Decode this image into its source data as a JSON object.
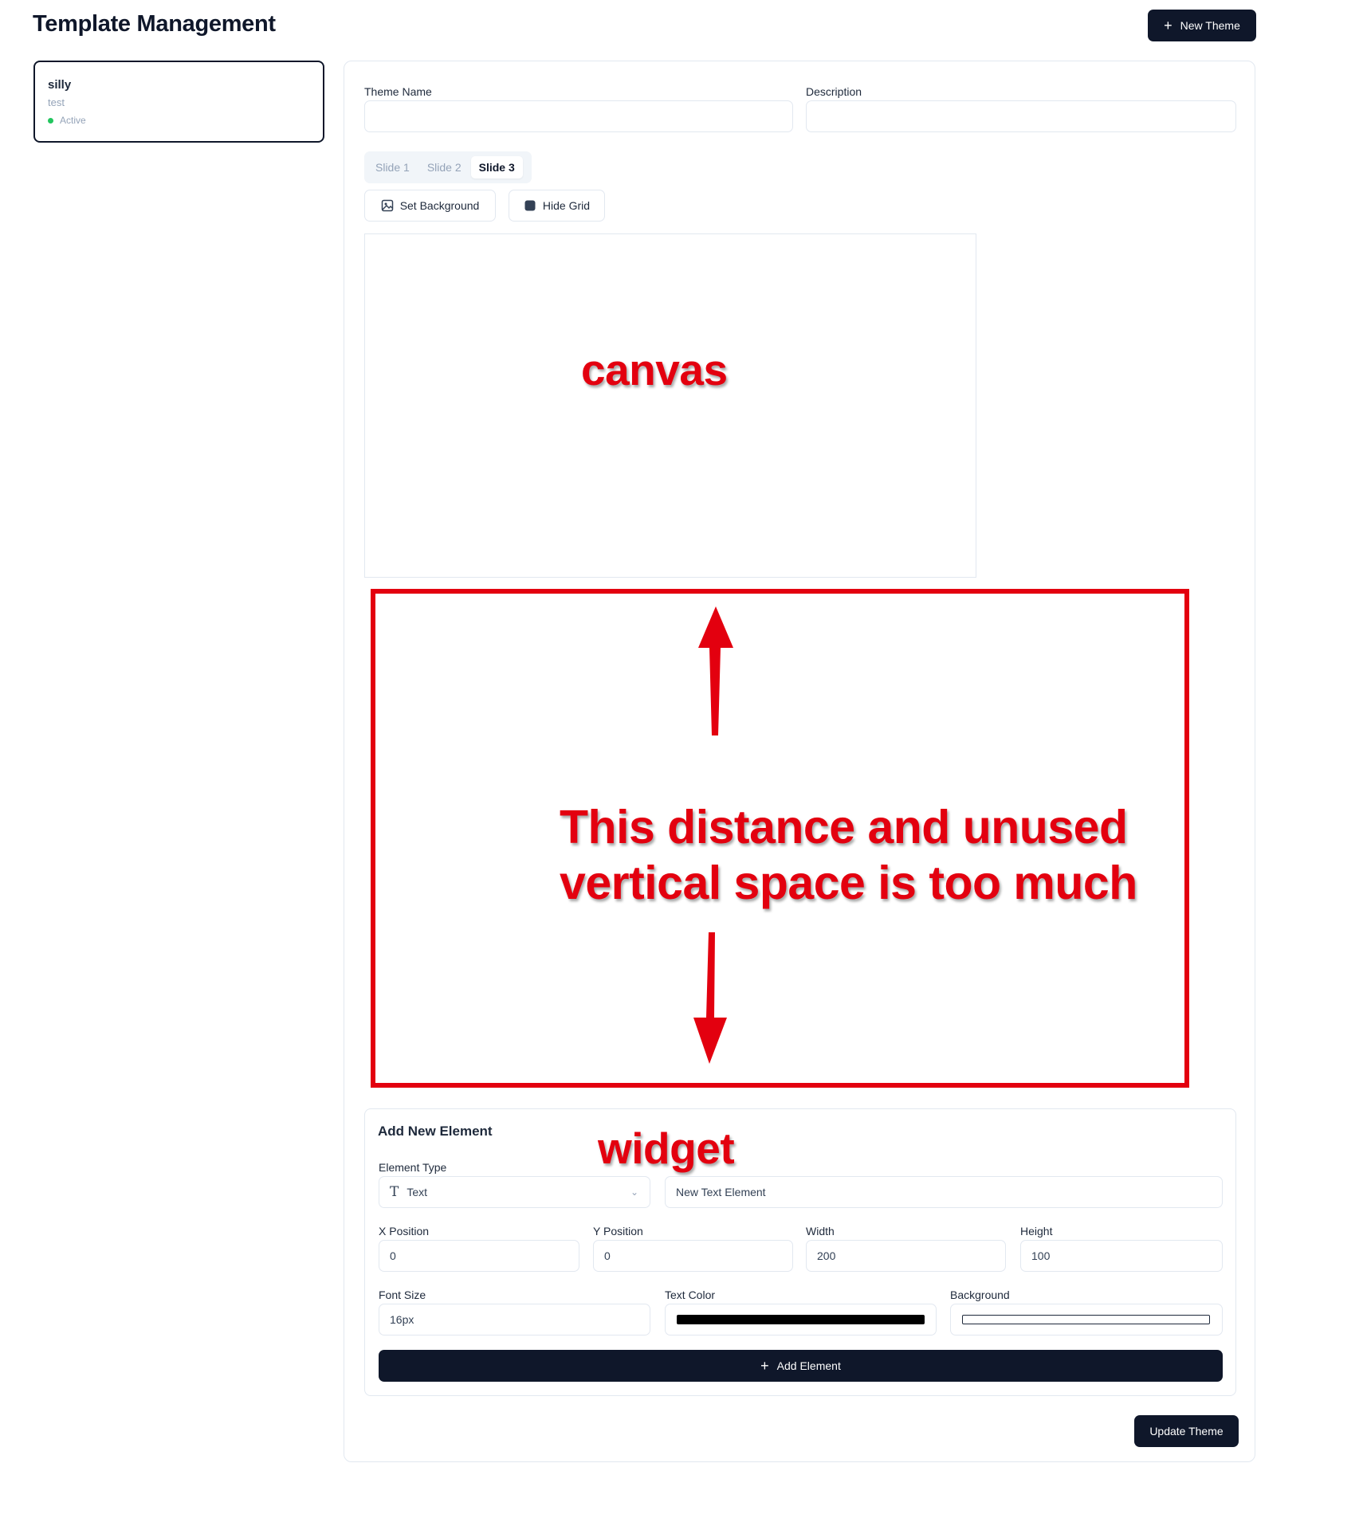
{
  "page": {
    "title": "Template Management"
  },
  "header": {
    "new_theme_label": "New Theme",
    "new_theme_icon": "plus-icon"
  },
  "sidebar": {
    "themes": [
      {
        "name": "silly",
        "description": "test",
        "status": "Active",
        "status_color": "#22c55e"
      }
    ]
  },
  "form": {
    "theme_name_label": "Theme Name",
    "theme_name_value": "",
    "description_label": "Description",
    "description_value": ""
  },
  "slides": {
    "tabs": [
      "Slide 1",
      "Slide 2",
      "Slide 3"
    ],
    "active": "Slide 3"
  },
  "toolbar": {
    "set_background_label": "Set Background",
    "set_background_icon": "image-icon",
    "hide_grid_label": "Hide Grid",
    "hide_grid_icon": "grid-square-icon"
  },
  "widget": {
    "title": "Add New Element",
    "element_type_label": "Element Type",
    "element_type_value": "Text",
    "element_type_icon": "text-type-icon",
    "content_value": "New Text Element",
    "x_label": "X Position",
    "x_value": "0",
    "y_label": "Y Position",
    "y_value": "0",
    "width_label": "Width",
    "width_value": "200",
    "height_label": "Height",
    "height_value": "100",
    "font_size_label": "Font Size",
    "font_size_value": "16px",
    "text_color_label": "Text Color",
    "text_color_value": "#000000",
    "background_label": "Background",
    "background_value": "#ffffff",
    "add_element_label": "Add Element"
  },
  "footer": {
    "update_theme_label": "Update Theme"
  },
  "annotations": {
    "canvas_label": "canvas",
    "note_line1": "This distance and unused",
    "note_line2": "vertical space is too much",
    "widget_label": "widget",
    "color": "#e3000f"
  },
  "theme_colors": {
    "primary": "#0f172a",
    "border": "#e2e8f0",
    "muted": "#94a3b8"
  }
}
